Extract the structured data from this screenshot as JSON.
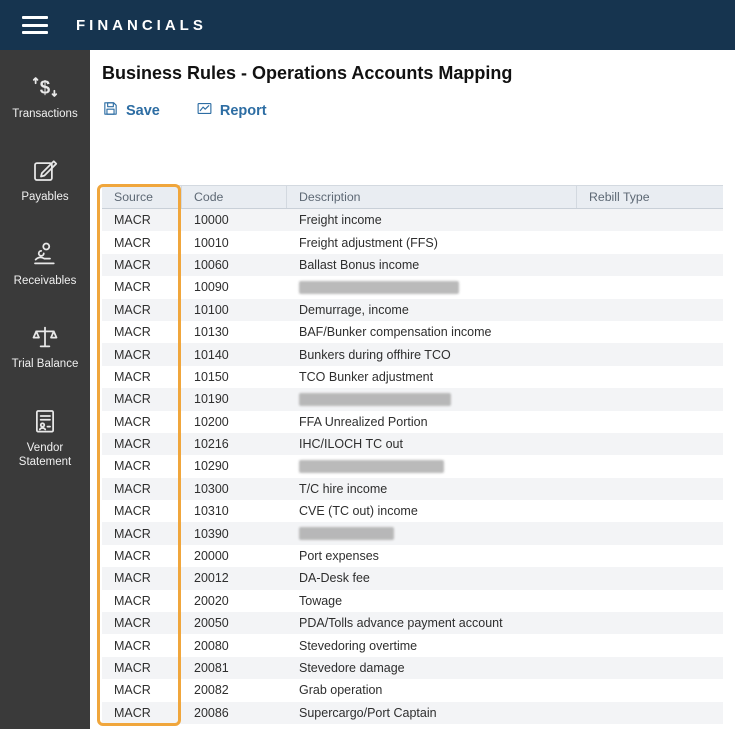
{
  "topbar": {
    "title": "FINANCIALS"
  },
  "sidebar": {
    "items": [
      {
        "label": "Transactions",
        "icon": "transactions-icon"
      },
      {
        "label": "Payables",
        "icon": "payables-icon"
      },
      {
        "label": "Receivables",
        "icon": "receivables-icon"
      },
      {
        "label": "Trial Balance",
        "icon": "trial-balance-icon"
      },
      {
        "label": "Vendor Statement",
        "icon": "vendor-statement-icon"
      }
    ]
  },
  "page": {
    "title": "Business Rules - Operations Accounts Mapping"
  },
  "toolbar": {
    "save_label": "Save",
    "report_label": "Report"
  },
  "table": {
    "columns": [
      "Source",
      "Code",
      "Description",
      "Rebill Type"
    ],
    "highlighted_column": "Source",
    "highlight_color": "#F0A63C",
    "rows": [
      {
        "source": "MACR",
        "code": "10000",
        "description": "Freight income",
        "rebill_type": ""
      },
      {
        "source": "MACR",
        "code": "10010",
        "description": "Freight adjustment (FFS)",
        "rebill_type": ""
      },
      {
        "source": "MACR",
        "code": "10060",
        "description": "Ballast Bonus income",
        "rebill_type": ""
      },
      {
        "source": "MACR",
        "code": "10090",
        "description": "",
        "redacted": true,
        "redacted_width": 160,
        "rebill_type": ""
      },
      {
        "source": "MACR",
        "code": "10100",
        "description": "Demurrage, income",
        "rebill_type": ""
      },
      {
        "source": "MACR",
        "code": "10130",
        "description": "BAF/Bunker compensation income",
        "rebill_type": ""
      },
      {
        "source": "MACR",
        "code": "10140",
        "description": "Bunkers during offhire TCO",
        "rebill_type": ""
      },
      {
        "source": "MACR",
        "code": "10150",
        "description": "TCO Bunker adjustment",
        "rebill_type": ""
      },
      {
        "source": "MACR",
        "code": "10190",
        "description": "",
        "redacted": true,
        "redacted_width": 152,
        "rebill_type": ""
      },
      {
        "source": "MACR",
        "code": "10200",
        "description": "FFA Unrealized Portion",
        "rebill_type": ""
      },
      {
        "source": "MACR",
        "code": "10216",
        "description": "IHC/ILOCH TC out",
        "rebill_type": ""
      },
      {
        "source": "MACR",
        "code": "10290",
        "description": "",
        "redacted": true,
        "redacted_width": 145,
        "rebill_type": ""
      },
      {
        "source": "MACR",
        "code": "10300",
        "description": "T/C hire income",
        "rebill_type": ""
      },
      {
        "source": "MACR",
        "code": "10310",
        "description": "CVE (TC out) income",
        "rebill_type": ""
      },
      {
        "source": "MACR",
        "code": "10390",
        "description": "",
        "redacted": true,
        "redacted_width": 95,
        "rebill_type": ""
      },
      {
        "source": "MACR",
        "code": "20000",
        "description": "Port expenses",
        "rebill_type": ""
      },
      {
        "source": "MACR",
        "code": "20012",
        "description": "DA-Desk fee",
        "rebill_type": ""
      },
      {
        "source": "MACR",
        "code": "20020",
        "description": "Towage",
        "rebill_type": ""
      },
      {
        "source": "MACR",
        "code": "20050",
        "description": "PDA/Tolls advance payment account",
        "rebill_type": ""
      },
      {
        "source": "MACR",
        "code": "20080",
        "description": "Stevedoring overtime",
        "rebill_type": ""
      },
      {
        "source": "MACR",
        "code": "20081",
        "description": "Stevedore damage",
        "rebill_type": ""
      },
      {
        "source": "MACR",
        "code": "20082",
        "description": "Grab operation",
        "rebill_type": ""
      },
      {
        "source": "MACR",
        "code": "20086",
        "description": "Supercargo/Port Captain",
        "rebill_type": ""
      }
    ]
  }
}
